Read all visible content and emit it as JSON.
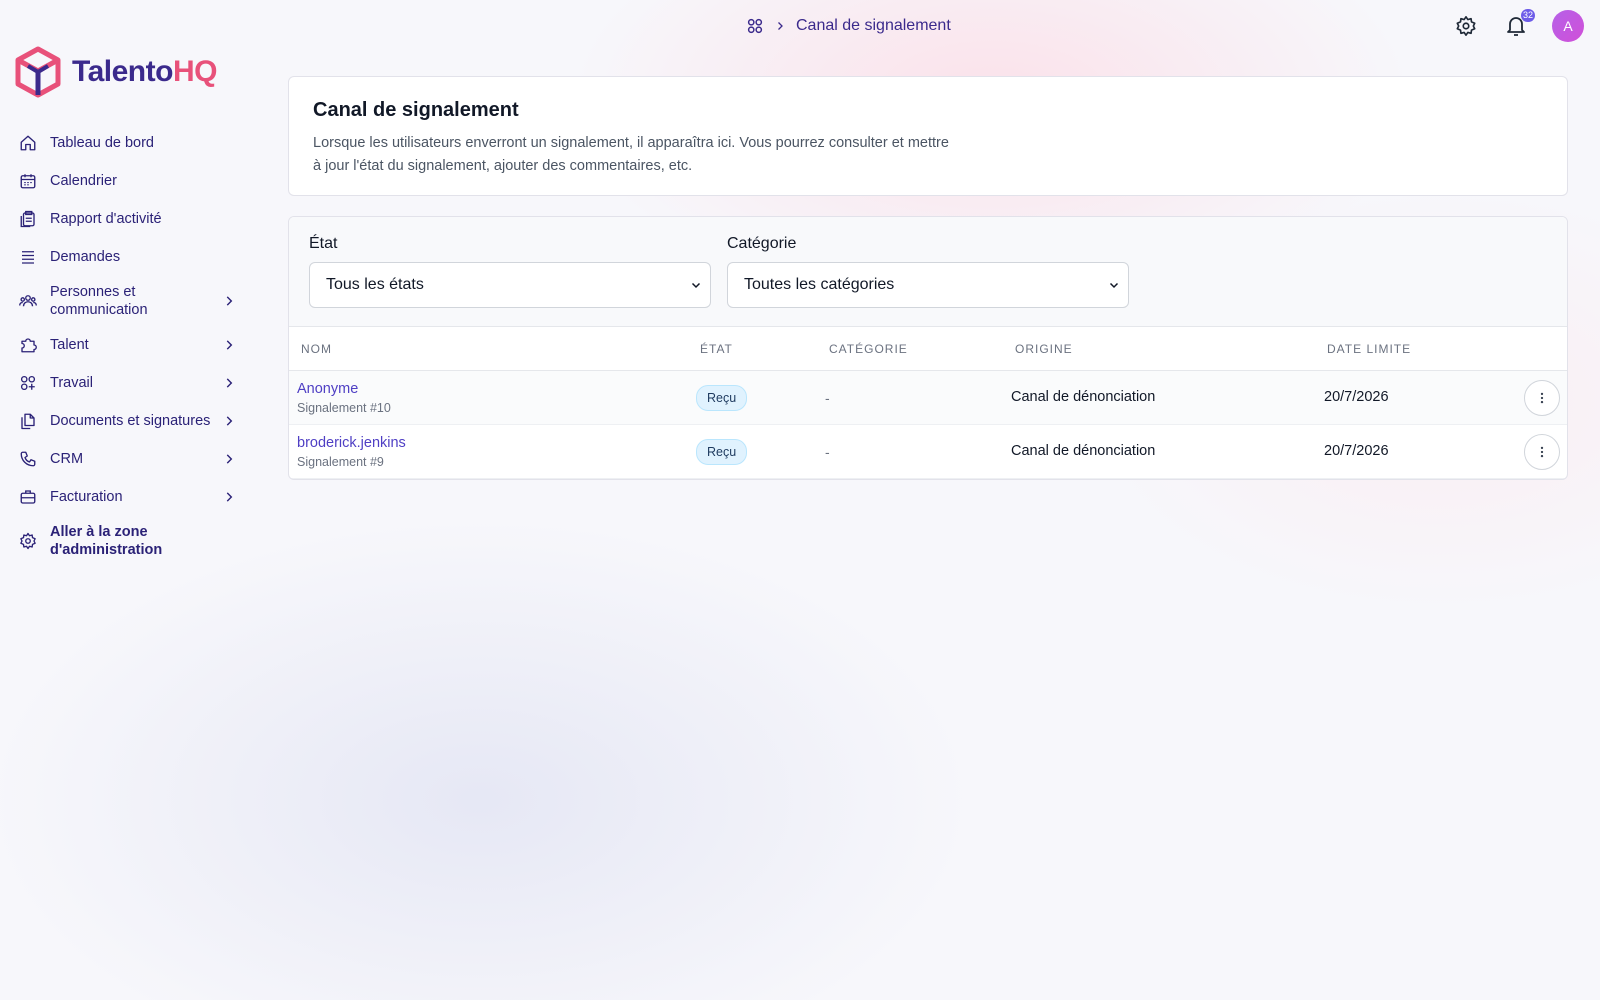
{
  "brand": {
    "part1": "Talento",
    "part2": "HQ",
    "color1": "#3b2a8c",
    "color2": "#e8517a"
  },
  "sidebar": {
    "items": [
      {
        "label": "Tableau de bord",
        "icon": "home-icon",
        "expandable": false
      },
      {
        "label": "Calendrier",
        "icon": "calendar-icon",
        "expandable": false
      },
      {
        "label": "Rapport d'activité",
        "icon": "clipboard-icon",
        "expandable": false
      },
      {
        "label": "Demandes",
        "icon": "stack-icon",
        "expandable": false
      },
      {
        "label": "Personnes et communication",
        "icon": "users-icon",
        "expandable": true
      },
      {
        "label": "Talent",
        "icon": "puzzle-icon",
        "expandable": true
      },
      {
        "label": "Travail",
        "icon": "grid-plus-icon",
        "expandable": true
      },
      {
        "label": "Documents et signatures",
        "icon": "documents-icon",
        "expandable": true
      },
      {
        "label": "CRM",
        "icon": "phone-icon",
        "expandable": true
      },
      {
        "label": "Facturation",
        "icon": "briefcase-icon",
        "expandable": true
      },
      {
        "label": "Aller à la zone d'administration",
        "icon": "gear-icon",
        "expandable": false
      }
    ]
  },
  "header": {
    "breadcrumb": {
      "current": "Canal de signalement"
    },
    "notifications_count": "32",
    "avatar_initial": "A"
  },
  "intro": {
    "title": "Canal de signalement",
    "description": "Lorsque les utilisateurs enverront un signalement, il apparaîtra ici. Vous pourrez consulter et mettre à jour l'état du signalement, ajouter des commentaires, etc."
  },
  "filters": {
    "state": {
      "label": "État",
      "value": "Tous les états"
    },
    "category": {
      "label": "Catégorie",
      "value": "Toutes les catégories"
    }
  },
  "table": {
    "columns": [
      "NOM",
      "ÉTAT",
      "CATÉGORIE",
      "ORIGINE",
      "DATE LIMITE"
    ],
    "rows": [
      {
        "name": "Anonyme",
        "ref": "Signalement #10",
        "state": "Reçu",
        "category": "-",
        "origin": "Canal de dénonciation",
        "deadline": "20/7/2026"
      },
      {
        "name": "broderick.jenkins",
        "ref": "Signalement #9",
        "state": "Reçu",
        "category": "-",
        "origin": "Canal de dénonciation",
        "deadline": "20/7/2026"
      }
    ]
  }
}
